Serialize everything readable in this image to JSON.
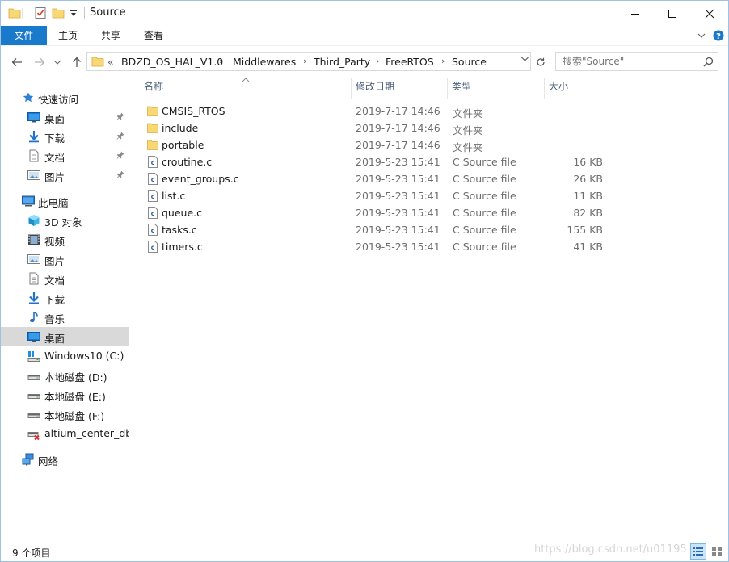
{
  "window": {
    "title": "Source"
  },
  "ribbon": {
    "tabs": [
      "文件",
      "主页",
      "共享",
      "查看"
    ]
  },
  "address": {
    "overflow": "«",
    "segments": [
      "BDZD_OS_HAL_V1.0",
      "Middlewares",
      "Third_Party",
      "FreeRTOS",
      "Source"
    ]
  },
  "search": {
    "placeholder": "搜索\"Source\""
  },
  "nav": {
    "quick_access": "快速访问",
    "quick": [
      "桌面",
      "下载",
      "文档",
      "图片"
    ],
    "this_pc": "此电脑",
    "pc_items": [
      "3D 对象",
      "视频",
      "图片",
      "文档",
      "下载",
      "音乐",
      "桌面"
    ],
    "drives": [
      "Windows10 (C:)",
      "本地磁盘 (D:)",
      "本地磁盘 (E:)",
      "本地磁盘 (F:)",
      "altium_center_db ("
    ],
    "network": "网络"
  },
  "columns": {
    "name": "名称",
    "date": "修改日期",
    "type": "类型",
    "size": "大小"
  },
  "files": [
    {
      "name": "CMSIS_RTOS",
      "date": "2019-7-17 14:46",
      "type": "文件夹",
      "size": "",
      "kind": "folder"
    },
    {
      "name": "include",
      "date": "2019-7-17 14:46",
      "type": "文件夹",
      "size": "",
      "kind": "folder"
    },
    {
      "name": "portable",
      "date": "2019-7-17 14:46",
      "type": "文件夹",
      "size": "",
      "kind": "folder"
    },
    {
      "name": "croutine.c",
      "date": "2019-5-23 15:41",
      "type": "C Source file",
      "size": "16 KB",
      "kind": "file"
    },
    {
      "name": "event_groups.c",
      "date": "2019-5-23 15:41",
      "type": "C Source file",
      "size": "26 KB",
      "kind": "file"
    },
    {
      "name": "list.c",
      "date": "2019-5-23 15:41",
      "type": "C Source file",
      "size": "11 KB",
      "kind": "file"
    },
    {
      "name": "queue.c",
      "date": "2019-5-23 15:41",
      "type": "C Source file",
      "size": "82 KB",
      "kind": "file"
    },
    {
      "name": "tasks.c",
      "date": "2019-5-23 15:41",
      "type": "C Source file",
      "size": "155 KB",
      "kind": "file"
    },
    {
      "name": "timers.c",
      "date": "2019-5-23 15:41",
      "type": "C Source file",
      "size": "41 KB",
      "kind": "file"
    }
  ],
  "status": {
    "count": "9 个项目"
  },
  "watermark": "https://blog.csdn.net/u01195",
  "colors": {
    "accent": "#1979ca",
    "folder": "#f8d775",
    "selection": "#d9d9d9"
  }
}
